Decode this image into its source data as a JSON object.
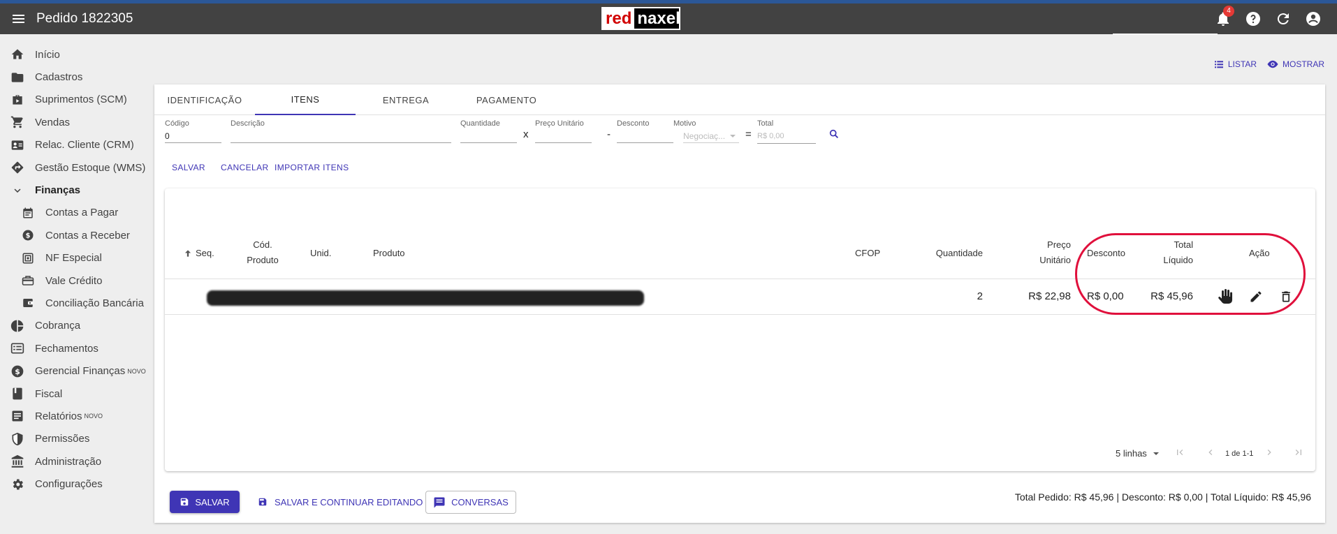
{
  "app": {
    "title": "Pedido 1822305",
    "logo_red": "red",
    "logo_white": "naxel",
    "notification_count": "4"
  },
  "sidebar": {
    "items": [
      {
        "label": "Início",
        "icon": "home-icon"
      },
      {
        "label": "Cadastros",
        "icon": "folder-icon"
      },
      {
        "label": "Suprimentos (SCM)",
        "icon": "briefcase-icon"
      },
      {
        "label": "Vendas",
        "icon": "cart-icon"
      },
      {
        "label": "Relac. Cliente (CRM)",
        "icon": "contact-card-icon"
      },
      {
        "label": "Gestão Estoque (WMS)",
        "icon": "directions-icon"
      },
      {
        "label": "Finanças",
        "icon": "chevron-down-icon"
      },
      {
        "label": "Contas a Pagar",
        "icon": "calendar-icon"
      },
      {
        "label": "Contas a Receber",
        "icon": "dollar-circle-icon"
      },
      {
        "label": "NF Especial",
        "icon": "nf-icon"
      },
      {
        "label": "Vale Crédito",
        "icon": "card-icon"
      },
      {
        "label": "Conciliação Bancária",
        "icon": "wallet-icon"
      },
      {
        "label": "Cobrança",
        "icon": "pie-chart-icon"
      },
      {
        "label": "Fechamentos",
        "icon": "list-box-icon"
      },
      {
        "label": "Gerencial Finanças",
        "icon": "dollar-circle-icon",
        "badge": "NOVO"
      },
      {
        "label": "Fiscal",
        "icon": "book-icon"
      },
      {
        "label": "Relatórios",
        "icon": "report-icon",
        "badge": "NOVO"
      },
      {
        "label": "Permissões",
        "icon": "shield-icon"
      },
      {
        "label": "Administração",
        "icon": "bank-icon"
      },
      {
        "label": "Configurações",
        "icon": "gear-icon"
      }
    ]
  },
  "top_links": {
    "list": "LISTAR",
    "show": "MOSTRAR"
  },
  "tabs": [
    "IDENTIFICAÇÃO",
    "ITENS",
    "ENTREGA",
    "PAGAMENTO"
  ],
  "active_tab": "ITENS",
  "form": {
    "codigo": {
      "label": "Código",
      "value": "0"
    },
    "descricao": {
      "label": "Descrição",
      "value": ""
    },
    "quantidade": {
      "label": "Quantidade",
      "value": ""
    },
    "op_times": "x",
    "preco": {
      "label": "Preço Unitário",
      "value": ""
    },
    "op_minus": "-",
    "desconto": {
      "label": "Desconto",
      "value": ""
    },
    "motivo": {
      "label": "Motivo",
      "placeholder": "Negociaç..."
    },
    "op_equals": "=",
    "total": {
      "label": "Total",
      "placeholder": "R$ 0,00"
    }
  },
  "form_actions": {
    "save": "SALVAR",
    "cancel": "CANCELAR",
    "import": "IMPORTAR ITENS"
  },
  "table": {
    "headers": {
      "seq": "Seq.",
      "cod_produto": "Cód.\nProduto",
      "unid": "Unid.",
      "produto": "Produto",
      "cfop": "CFOP",
      "quantidade": "Quantidade",
      "preco_unitario": "Preço\nUnitário",
      "desconto": "Desconto",
      "total_liquido": "Total\nLíquido",
      "acao": "Ação"
    },
    "rows": [
      {
        "quantidade": "2",
        "preco_unitario": "R$ 22,98",
        "desconto": "R$ 0,00",
        "total_liquido": "R$ 45,96"
      }
    ],
    "pagination": {
      "rows_per_page": "5 linhas",
      "range": "1 de 1-1"
    }
  },
  "footer": {
    "save": "SALVAR",
    "save_continue": "SALVAR E CONTINUAR EDITANDO",
    "conversations": "CONVERSAS",
    "summary": "Total Pedido: R$ 45,96 | Desconto: R$ 0,00 | Total Líquido: R$ 45,96"
  },
  "colors": {
    "appbar": "#424242",
    "accent": "#3f35b5",
    "annotation": "#e0103c"
  }
}
